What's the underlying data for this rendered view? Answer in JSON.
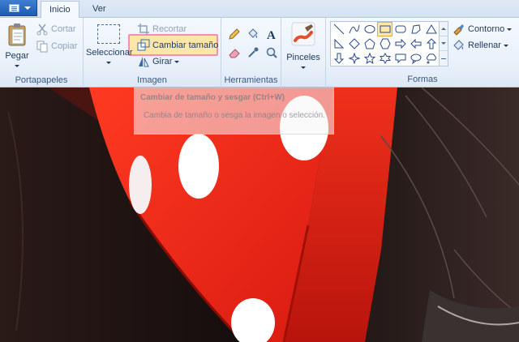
{
  "tabs": {
    "inicio": "Inicio",
    "ver": "Ver"
  },
  "portapapeles": {
    "pegar": "Pegar",
    "cortar": "Cortar",
    "copiar": "Copiar",
    "label": "Portapapeles"
  },
  "imagen": {
    "seleccionar": "Seleccionar",
    "recortar": "Recortar",
    "cambiar": "Cambiar tamaño",
    "girar": "Girar",
    "label": "Imagen"
  },
  "herramientas": {
    "label": "Herramientas"
  },
  "pinceles": {
    "label": "Pinceles"
  },
  "formas": {
    "label": "Formas",
    "contorno": "Contorno",
    "rellenar": "Rellenar"
  },
  "tooltip": {
    "title": "Cambiar de tamaño y sesgar (Ctrl+W)",
    "body": "Cambia de tamaño o sesga la imagen o selección."
  },
  "colors": {
    "accent": "#1d5bb0",
    "highlight": "#fde7a8",
    "highlight_border": "#f28fb6",
    "ribbon_bg": "#f5f9fe"
  }
}
